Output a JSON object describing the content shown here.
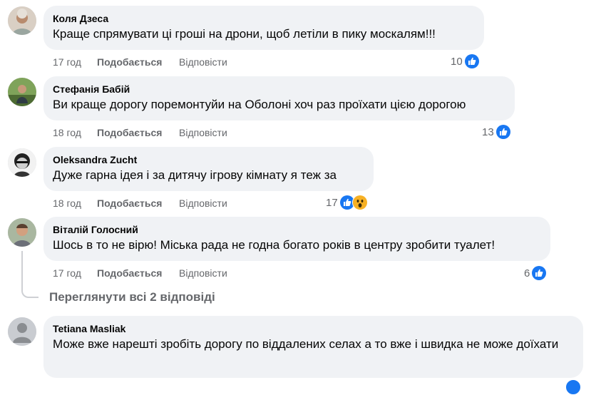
{
  "comments": [
    {
      "author": "Коля Дзеса",
      "text": "Краще спрямувати ці гроші на дрони, щоб летіли в пику москалям!!!",
      "time": "17 год",
      "like_label": "Подобається",
      "reply_label": "Відповісти",
      "reaction_count": "10",
      "reactions": [
        "like-icon"
      ]
    },
    {
      "author": "Стефанія Бабій",
      "text": "Ви краще дорогу поремонтуйи на Оболоні хоч раз проїхати цією дорогою",
      "time": "18 год",
      "like_label": "Подобається",
      "reply_label": "Відповісти",
      "reaction_count": "13",
      "reactions": [
        "like-icon"
      ]
    },
    {
      "author": "Oleksandra Zucht",
      "text": "Дуже гарна ідея і за дитячу ігрову кімнату я теж за",
      "time": "18 год",
      "like_label": "Подобається",
      "reply_label": "Відповісти",
      "reaction_count": "17",
      "reactions": [
        "like-icon",
        "wow-icon"
      ]
    },
    {
      "author": "Віталій Голосний",
      "text": "Шось в то не вірю! Міська рада не годна богато років в центру зробити туалет!",
      "time": "17 год",
      "like_label": "Подобається",
      "reply_label": "Відповісти",
      "reaction_count": "6",
      "reactions": [
        "like-icon"
      ]
    },
    {
      "author": "Tetiana Masliak",
      "text": "Може вже нарешті зробіть дорогу по віддалених селах а то вже і швидка не може доїхати"
    }
  ],
  "view_replies_label": "Переглянути всі 2 відповіді",
  "colors": {
    "bubble": "#f0f2f5",
    "meta_text": "#65676b",
    "like_blue": "#1877f2",
    "wow_yellow": "#f7b125"
  }
}
